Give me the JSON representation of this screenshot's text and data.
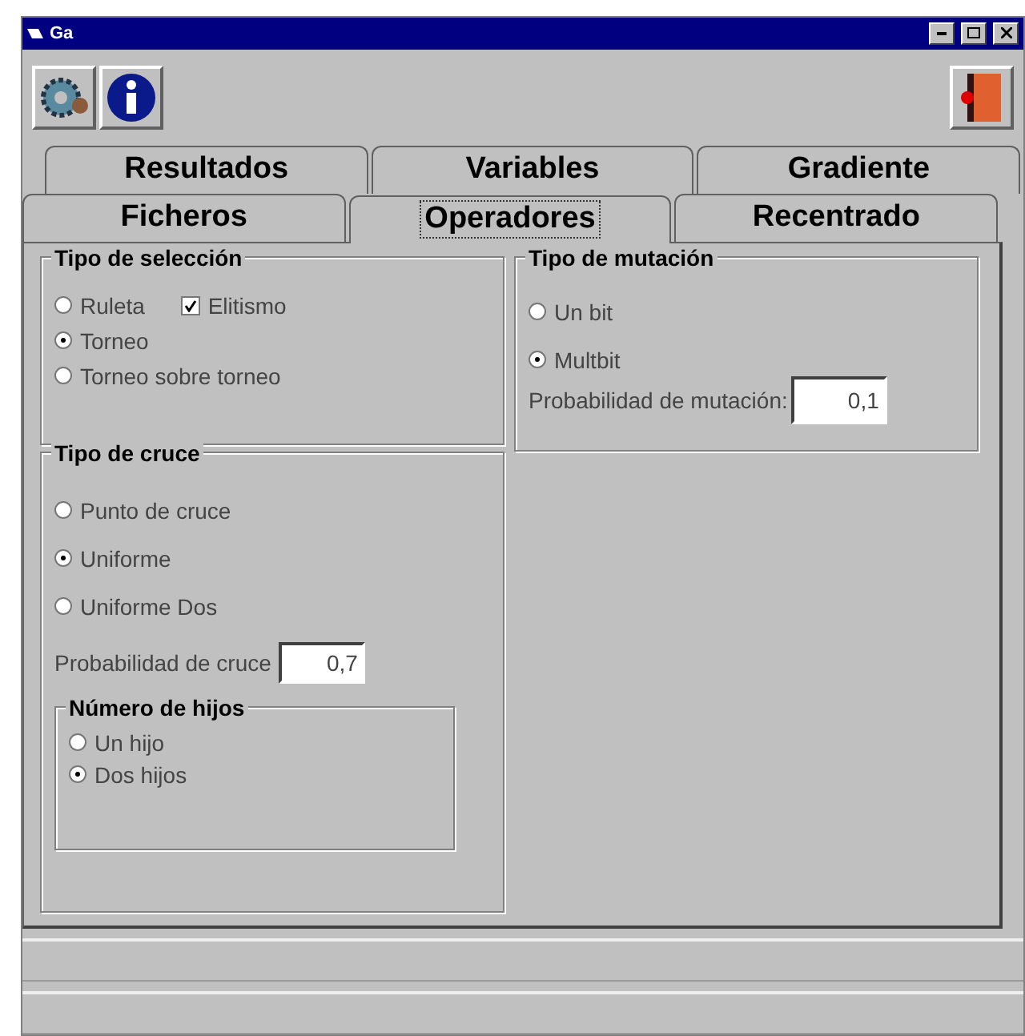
{
  "window": {
    "title": "Ga"
  },
  "tab_rows": [
    [
      {
        "label": "Resultados",
        "selected": false
      },
      {
        "label": "Variables",
        "selected": false
      },
      {
        "label": "Gradiente",
        "selected": false
      }
    ],
    [
      {
        "label": "Ficheros",
        "selected": false
      },
      {
        "label": "Operadores",
        "selected": true
      },
      {
        "label": "Recentrado",
        "selected": false
      }
    ]
  ],
  "seleccion": {
    "title": "Tipo de selección",
    "options": [
      {
        "label": "Ruleta",
        "selected": false
      },
      {
        "label": "Torneo",
        "selected": true
      },
      {
        "label": "Torneo sobre torneo",
        "selected": false
      }
    ],
    "elitismo": {
      "label": "Elitismo",
      "checked": true
    }
  },
  "cruce": {
    "title": "Tipo de cruce",
    "options": [
      {
        "label": "Punto de cruce",
        "selected": false
      },
      {
        "label": "Uniforme",
        "selected": true
      },
      {
        "label": "Uniforme Dos",
        "selected": false
      }
    ],
    "probability": {
      "label": "Probabilidad de cruce",
      "value": "0,7"
    },
    "hijos": {
      "title": "Número de hijos",
      "options": [
        {
          "label": "Un hijo",
          "selected": false
        },
        {
          "label": "Dos hijos",
          "selected": true
        }
      ]
    }
  },
  "mutacion": {
    "title": "Tipo de mutación",
    "options": [
      {
        "label": "Un bit",
        "selected": false
      },
      {
        "label": "Multbit",
        "selected": true
      }
    ],
    "probability": {
      "label": "Probabilidad de mutación:",
      "value": "0,1"
    }
  }
}
